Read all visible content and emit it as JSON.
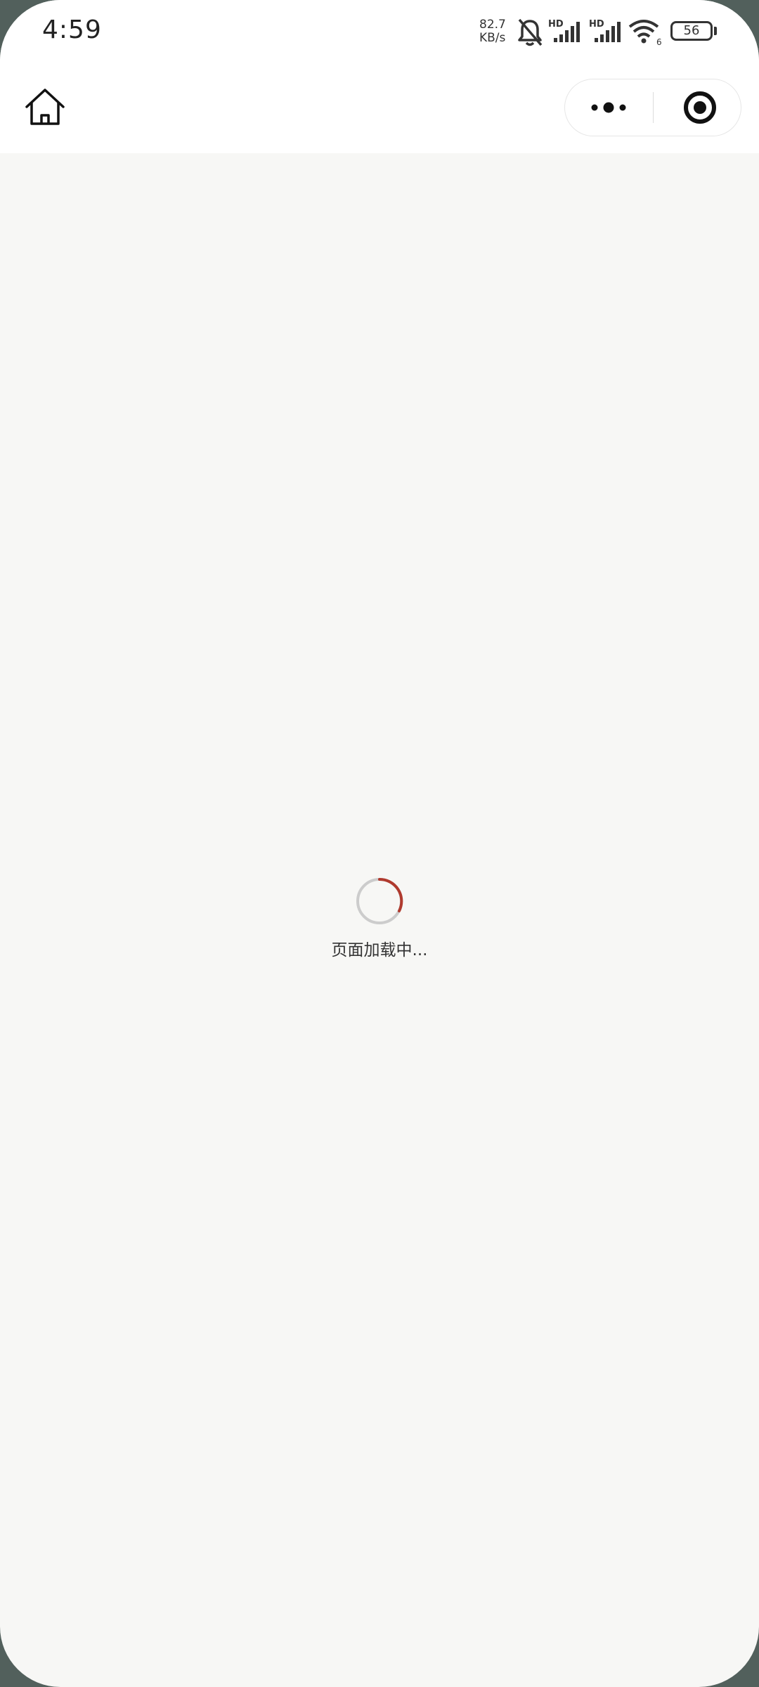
{
  "status_bar": {
    "time": "4:59",
    "net_speed_value": "82.7",
    "net_speed_unit": "KB/s",
    "signal1_label": "HD",
    "signal2_label": "HD",
    "wifi_label": "6",
    "battery": "56"
  },
  "nav": {
    "home_icon": "home-icon",
    "more_icon": "more-dots-icon",
    "close_icon": "target-close-icon"
  },
  "loading": {
    "text": "页面加载中...",
    "spinner_color": "#b03a2e",
    "spinner_track_color": "#cccccc"
  },
  "colors": {
    "background": "#f7f7f5",
    "bar": "#ffffff"
  }
}
